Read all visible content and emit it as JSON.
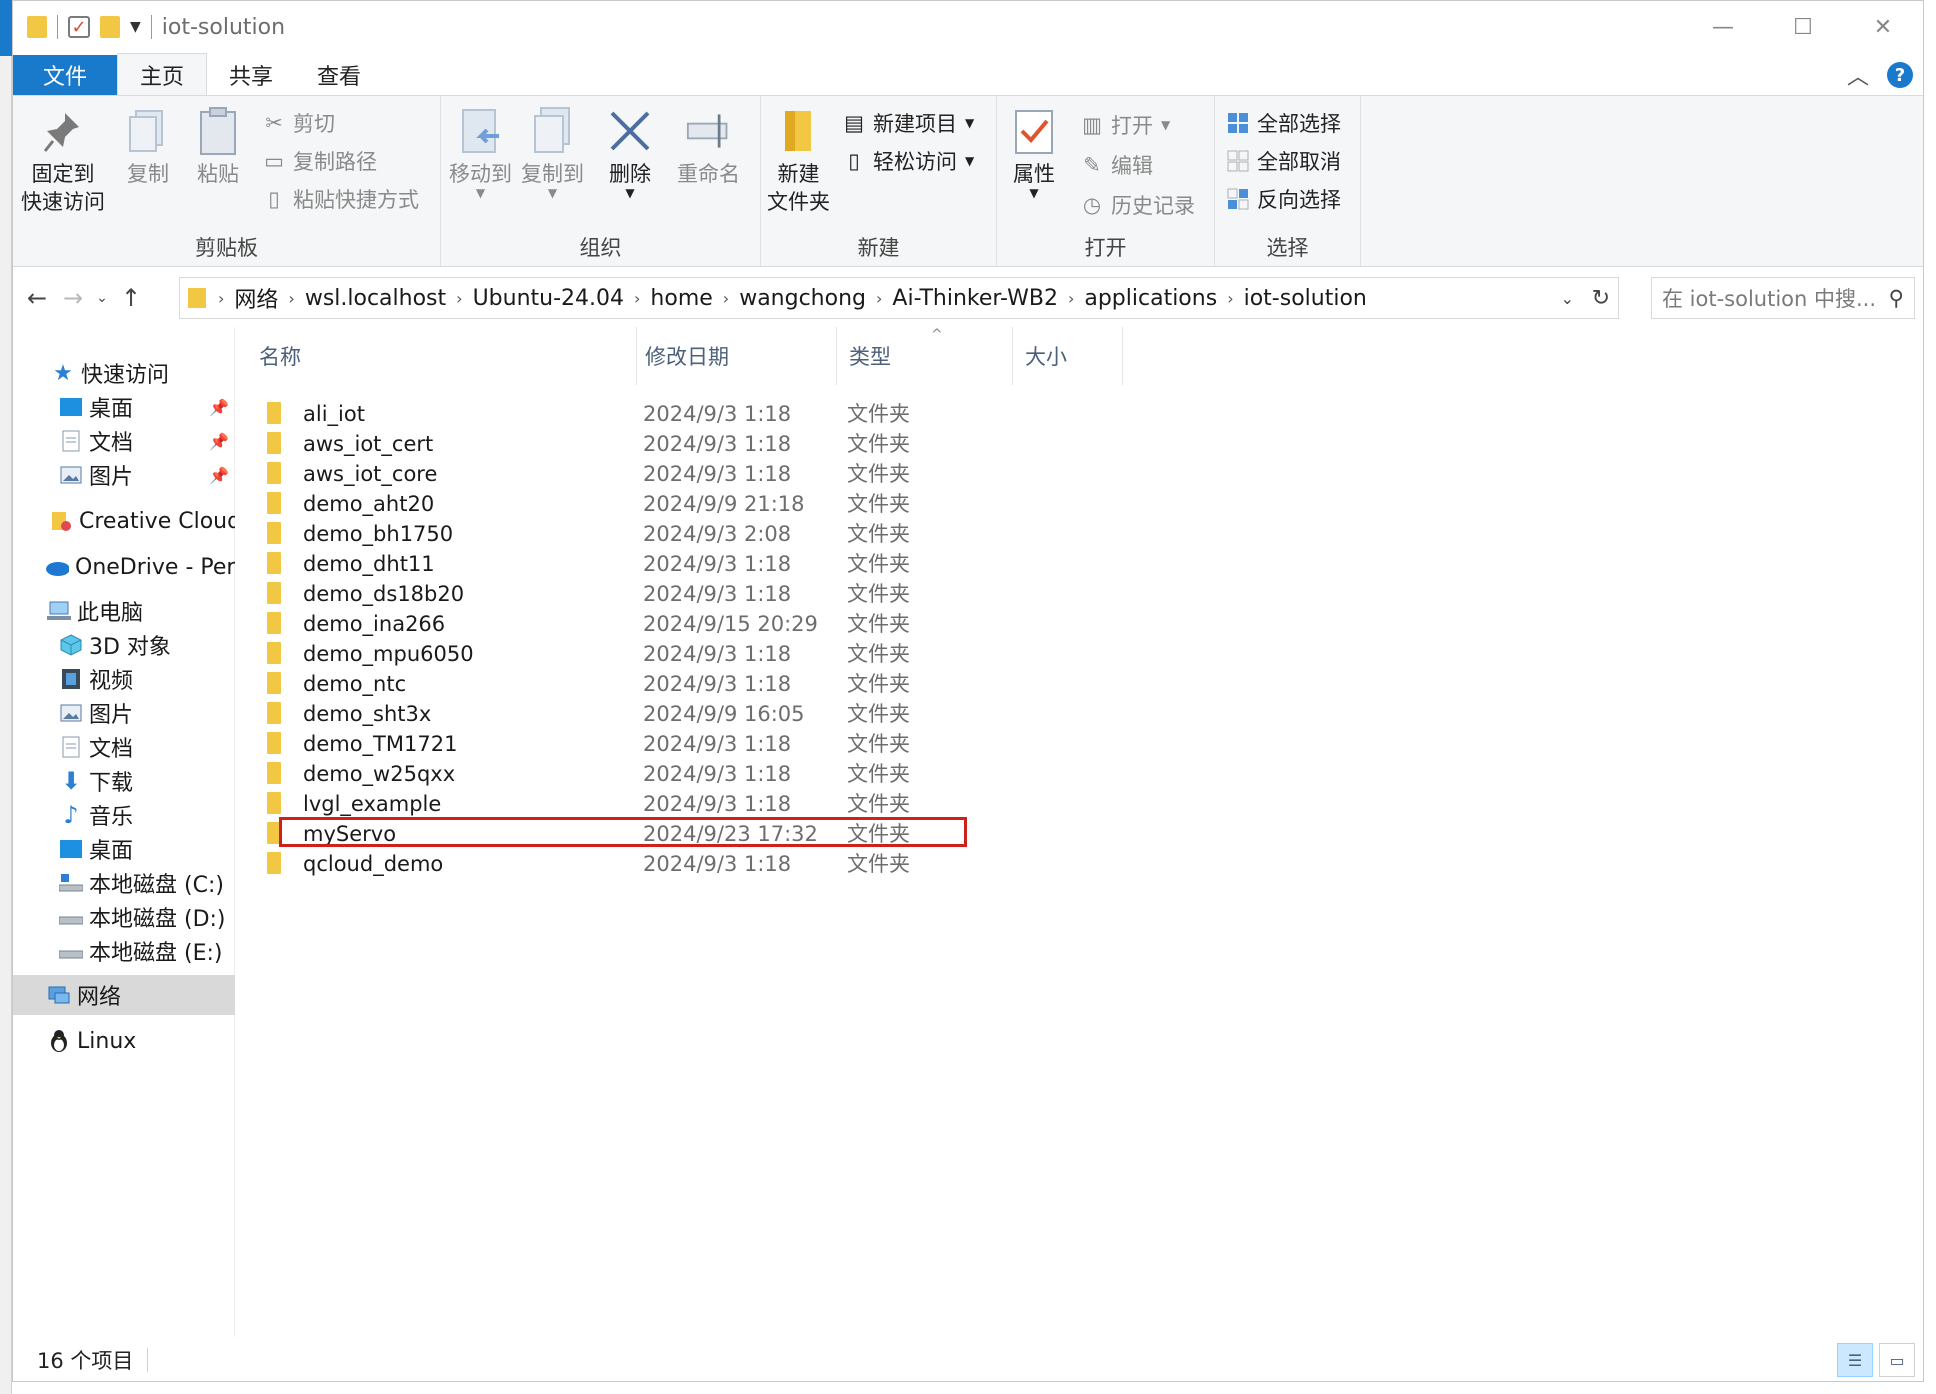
{
  "window": {
    "title": "iot-solution",
    "controls": {
      "minimize": "—",
      "maximize": "☐",
      "close": "✕"
    }
  },
  "tabs": [
    {
      "label": "文件"
    },
    {
      "label": "主页"
    },
    {
      "label": "共享"
    },
    {
      "label": "查看"
    }
  ],
  "ribbon": {
    "clipboard": {
      "label": "剪贴板",
      "pin_quick_access_1": "固定到",
      "pin_quick_access_2": "快速访问",
      "copy": "复制",
      "paste": "粘贴",
      "cut": "剪切",
      "copy_path": "复制路径",
      "paste_shortcut": "粘贴快捷方式"
    },
    "organize": {
      "label": "组织",
      "move_to": "移动到",
      "copy_to": "复制到",
      "delete": "删除",
      "rename": "重命名"
    },
    "new": {
      "label": "新建",
      "new_folder_1": "新建",
      "new_folder_2": "文件夹",
      "new_item": "新建项目",
      "easy_access": "轻松访问"
    },
    "open": {
      "label": "打开",
      "properties": "属性",
      "open": "打开",
      "edit": "编辑",
      "history": "历史记录"
    },
    "select": {
      "label": "选择",
      "select_all": "全部选择",
      "select_none": "全部取消",
      "invert": "反向选择"
    }
  },
  "address": {
    "crumbs": [
      "网络",
      "wsl.localhost",
      "Ubuntu-24.04",
      "home",
      "wangchong",
      "Ai-Thinker-WB2",
      "applications",
      "iot-solution"
    ],
    "search_placeholder": "在 iot-solution 中搜..."
  },
  "nav": {
    "quick_access": "快速访问",
    "qa_desktop": "桌面",
    "qa_docs": "文档",
    "qa_pictures": "图片",
    "creative_cloud": "Creative Cloud Files",
    "onedrive": "OneDrive - Persona",
    "this_pc": "此电脑",
    "objects3d": "3D 对象",
    "videos": "视频",
    "pictures": "图片",
    "documents": "文档",
    "downloads": "下载",
    "music": "音乐",
    "desktop": "桌面",
    "drive_c": "本地磁盘 (C:)",
    "drive_d": "本地磁盘 (D:)",
    "drive_e": "本地磁盘 (E:)",
    "network": "网络",
    "linux": "Linux"
  },
  "columns": {
    "name": "名称",
    "date": "修改日期",
    "type": "类型",
    "size": "大小"
  },
  "files": [
    {
      "name": "ali_iot",
      "date": "2024/9/3 1:18",
      "type": "文件夹"
    },
    {
      "name": "aws_iot_cert",
      "date": "2024/9/3 1:18",
      "type": "文件夹"
    },
    {
      "name": "aws_iot_core",
      "date": "2024/9/3 1:18",
      "type": "文件夹"
    },
    {
      "name": "demo_aht20",
      "date": "2024/9/9 21:18",
      "type": "文件夹"
    },
    {
      "name": "demo_bh1750",
      "date": "2024/9/3 2:08",
      "type": "文件夹"
    },
    {
      "name": "demo_dht11",
      "date": "2024/9/3 1:18",
      "type": "文件夹"
    },
    {
      "name": "demo_ds18b20",
      "date": "2024/9/3 1:18",
      "type": "文件夹"
    },
    {
      "name": "demo_ina266",
      "date": "2024/9/15 20:29",
      "type": "文件夹"
    },
    {
      "name": "demo_mpu6050",
      "date": "2024/9/3 1:18",
      "type": "文件夹"
    },
    {
      "name": "demo_ntc",
      "date": "2024/9/3 1:18",
      "type": "文件夹"
    },
    {
      "name": "demo_sht3x",
      "date": "2024/9/9 16:05",
      "type": "文件夹"
    },
    {
      "name": "demo_TM1721",
      "date": "2024/9/3 1:18",
      "type": "文件夹"
    },
    {
      "name": "demo_w25qxx",
      "date": "2024/9/3 1:18",
      "type": "文件夹"
    },
    {
      "name": "lvgl_example",
      "date": "2024/9/3 1:18",
      "type": "文件夹"
    },
    {
      "name": "myServo",
      "date": "2024/9/23 17:32",
      "type": "文件夹"
    },
    {
      "name": "qcloud_demo",
      "date": "2024/9/3 1:18",
      "type": "文件夹"
    }
  ],
  "status": {
    "count": "16 个项目"
  },
  "colors": {
    "accent": "#1979ca",
    "folder": "#f2c744",
    "highlight": "#d0201a"
  }
}
